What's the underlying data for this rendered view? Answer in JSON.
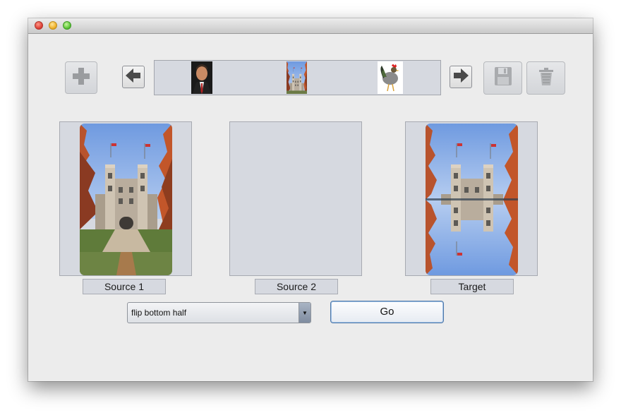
{
  "toolbar": {
    "add_icon": "plus-icon",
    "prev_icon": "arrow-left-icon",
    "next_icon": "arrow-right-icon",
    "save_icon": "floppy-disk-icon",
    "delete_icon": "trash-icon"
  },
  "thumbnails": [
    {
      "subject": "portrait"
    },
    {
      "subject": "building"
    },
    {
      "subject": "rooster"
    }
  ],
  "panels": {
    "source1_label": "Source 1",
    "source2_label": "Source 2",
    "target_label": "Target"
  },
  "controls": {
    "operation_selected": "flip bottom half",
    "go_label": "Go"
  },
  "colors": {
    "window_bg": "#ececec",
    "panel_bg": "#d6d9e0",
    "sky": "#8fb3e6",
    "foliage": "#c0552a",
    "stone": "#b9ad9d",
    "combo_arrow": "#8593a7"
  }
}
